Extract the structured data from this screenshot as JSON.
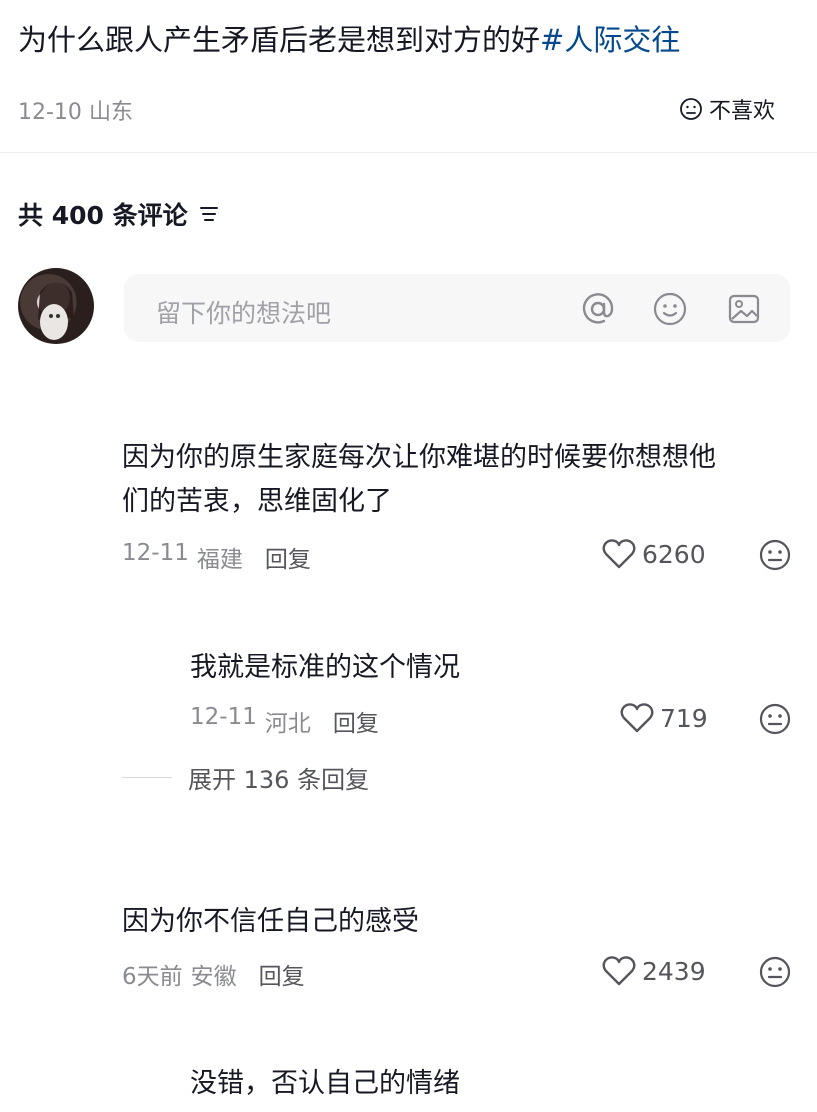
{
  "post": {
    "title": "为什么跟人产生矛盾后老是想到对方的好",
    "tag": "#人际交往",
    "date": "12-10",
    "location": "山东",
    "dislike_label": "不喜欢"
  },
  "comments_header": {
    "count_label": "共 400 条评论"
  },
  "composer": {
    "placeholder": "留下你的想法吧"
  },
  "comments": [
    {
      "text_line1": "因为你的原生家庭每次让你难堪的时候要你想想他",
      "text_line2": "们的苦衷，思维固化了",
      "date": "12-11",
      "location": "福建",
      "reply_label": "回复",
      "likes": "6260"
    },
    {
      "text": "我就是标准的这个情况",
      "date": "12-11",
      "location": "河北",
      "reply_label": "回复",
      "likes": "719"
    },
    {
      "text": "因为你不信任自己的感受",
      "date": "6天前",
      "location": "安徽",
      "reply_label": "回复",
      "likes": "2439"
    },
    {
      "text": "没错，否认自己的情绪"
    }
  ],
  "expand_replies_label": "展开 136 条回复",
  "colors": {
    "tag": "#04498d",
    "meta": "#8a8b91",
    "text": "#161823"
  }
}
